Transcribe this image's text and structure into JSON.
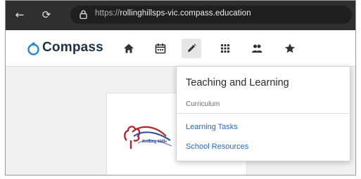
{
  "browser": {
    "url_prefix": "https://",
    "url_host": "rollinghillsps-vic.compass.education",
    "icons": {
      "back": "arrow-left-icon",
      "reload": "reload-icon",
      "lock": "lock-icon"
    }
  },
  "header": {
    "brand": "Compass",
    "brand_color": "#1b3246",
    "accent_color": "#1e88d8",
    "nav_icons": [
      "home-icon",
      "calendar-icon",
      "pencil-icon",
      "grid-icon",
      "people-icon",
      "star-icon"
    ],
    "active_nav": "pencil-icon"
  },
  "dropdown": {
    "title": "Teaching and Learning",
    "subtitle": "Curriculum",
    "links": [
      "Learning Tasks",
      "School Resources"
    ],
    "link_color": "#2767c4"
  },
  "content": {
    "logo_text": "Rolling Hills"
  }
}
